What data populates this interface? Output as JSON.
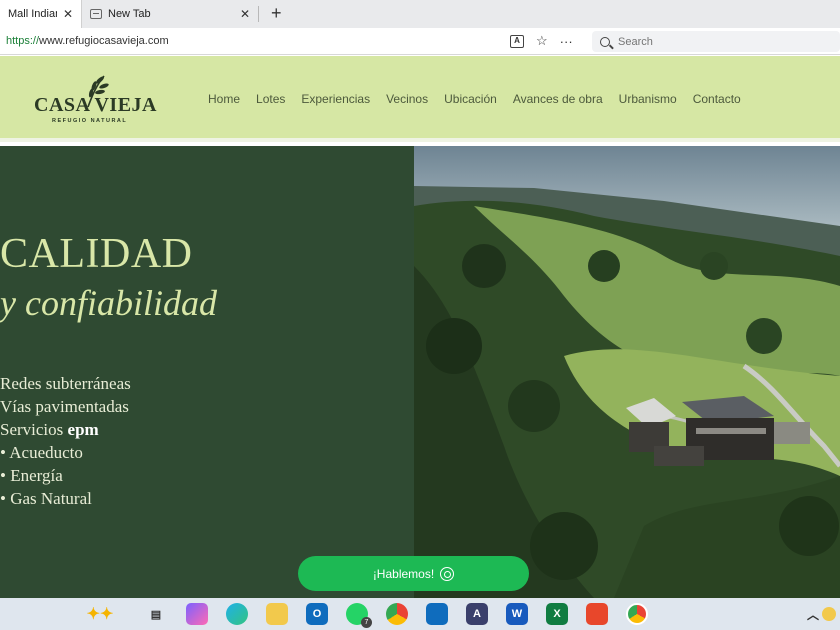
{
  "browser": {
    "tabs": [
      {
        "title": "Mall Indiana",
        "close": "✕",
        "active": true
      },
      {
        "title": "New Tab",
        "close": "✕",
        "active": false
      }
    ],
    "new_tab": "+",
    "url_scheme": "https://",
    "url_rest": "www.refugiocasavieja.com",
    "search_placeholder": "Search",
    "more": "···"
  },
  "site": {
    "logo_main": "CASA VIEJA",
    "logo_sub": "REFUGIO NATURAL",
    "nav": [
      "Home",
      "Lotes",
      "Experiencias",
      "Vecinos",
      "Ubicación",
      "Avances de obra",
      "Urbanismo",
      "Contacto"
    ],
    "hero_title": "CALIDAD",
    "hero_subtitle": "y confiabilidad",
    "features": [
      {
        "text": "Redes subterráneas"
      },
      {
        "text": "Vías pavimentadas"
      },
      {
        "text": "Servicios ",
        "bold": "epm"
      },
      {
        "text": "• Acueducto"
      },
      {
        "text": "• Energía"
      },
      {
        "text": "• Gas Natural"
      }
    ],
    "chat_button": "¡Hablemos!"
  },
  "taskbar": {
    "whatsapp_badge": "7"
  },
  "colors": {
    "header_bg": "#d6e7a4",
    "hero_bg": "#2f4a32",
    "hero_text": "#d9e7a8",
    "chat_button": "#1db954"
  }
}
